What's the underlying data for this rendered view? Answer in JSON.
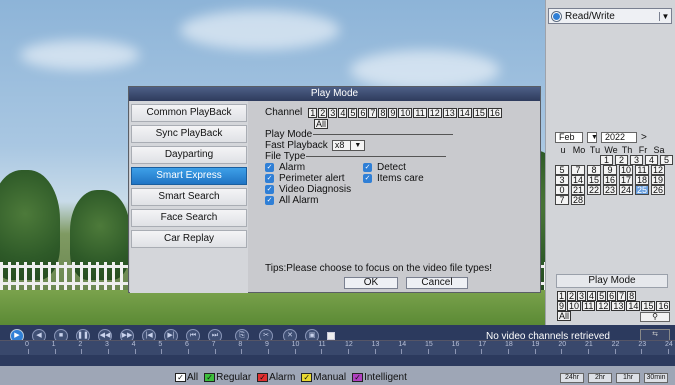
{
  "right_panel": {
    "mode_select": "Read/Write",
    "calendar": {
      "month": "Feb",
      "year": "2022",
      "next": ">",
      "dow": [
        "u",
        "Mo",
        "Tu",
        "We",
        "Th",
        "Fr",
        "Sa"
      ],
      "weeks": [
        [
          "",
          "",
          "",
          "1",
          "2",
          "3",
          "4",
          "5"
        ],
        [
          "5",
          "7",
          "8",
          "9",
          "10",
          "11",
          "12"
        ],
        [
          "3",
          "14",
          "15",
          "16",
          "17",
          "18",
          "19"
        ],
        [
          "0",
          "21",
          "22",
          "23",
          "24",
          "25",
          "26"
        ],
        [
          "7",
          "28"
        ]
      ],
      "today": "25"
    },
    "playmode_label": "Play Mode",
    "channels_row1": [
      "1",
      "2",
      "3",
      "4",
      "5",
      "6",
      "7",
      "8"
    ],
    "channels_row2": [
      "9",
      "10",
      "11",
      "12",
      "13",
      "14",
      "15",
      "16"
    ],
    "channels_all": "All",
    "search_icon": "magnifier-icon"
  },
  "dialog": {
    "title": "Play Mode",
    "menu": [
      "Common PlayBack",
      "Sync PlayBack",
      "Dayparting",
      "Smart Express",
      "Smart Search",
      "Face Search",
      "Car Replay"
    ],
    "active_menu": "Smart Express",
    "channel_label": "Channel",
    "channels": [
      "1",
      "2",
      "3",
      "4",
      "5",
      "6",
      "7",
      "8",
      "9",
      "10",
      "11",
      "12",
      "13",
      "14",
      "15",
      "16"
    ],
    "channel_all": "All",
    "play_mode_label": "Play Mode",
    "fast_playback_label": "Fast Playback",
    "fast_playback_value": "x8",
    "file_type_label": "File Type",
    "file_types": [
      {
        "label": "Alarm",
        "checked": true
      },
      {
        "label": "Detect",
        "checked": true
      },
      {
        "label": "Perimeter alert",
        "checked": true
      },
      {
        "label": "Items care",
        "checked": true
      },
      {
        "label": "Video Diagnosis",
        "checked": true
      },
      {
        "label": "All Alarm",
        "checked": true
      }
    ],
    "tips": "Tips:Please choose to focus on the video file types!",
    "ok_label": "OK",
    "cancel_label": "Cancel"
  },
  "toolbar": {
    "status": "No video channels retrieved",
    "timeline_ticks": [
      "0",
      "1",
      "2",
      "3",
      "4",
      "5",
      "6",
      "7",
      "8",
      "9",
      "10",
      "11",
      "12",
      "13",
      "14",
      "15",
      "16",
      "17",
      "18",
      "19",
      "20",
      "21",
      "22",
      "23",
      "24"
    ],
    "legend": [
      {
        "label": "All",
        "color": "#ffffff"
      },
      {
        "label": "Regular",
        "color": "#3cbf3c"
      },
      {
        "label": "Alarm",
        "color": "#e03030"
      },
      {
        "label": "Manual",
        "color": "#e8d830"
      },
      {
        "label": "Intelligent",
        "color": "#b040c0"
      }
    ],
    "zoom": [
      "24hr",
      "2hr",
      "1hr",
      "30min"
    ]
  }
}
